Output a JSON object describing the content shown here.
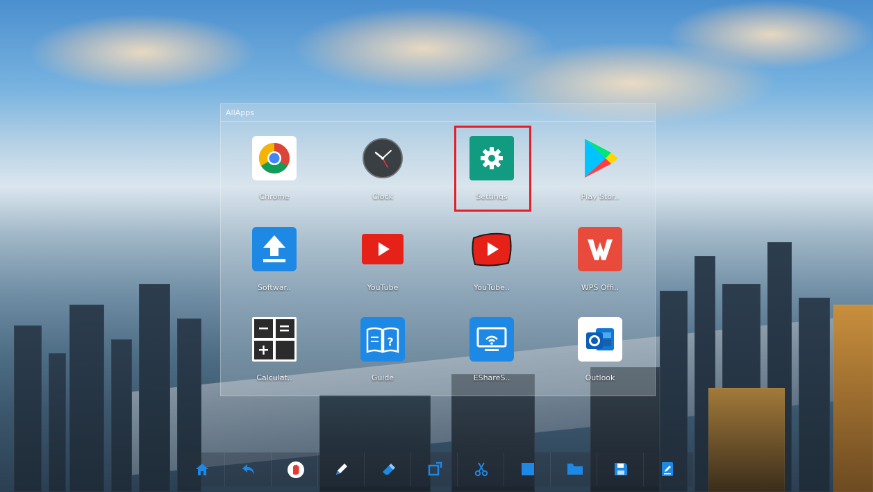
{
  "panel": {
    "title": "AllApps"
  },
  "apps": [
    {
      "label": "Chrome",
      "icon": "chrome-icon"
    },
    {
      "label": "Clock",
      "icon": "clock-icon"
    },
    {
      "label": "Settings",
      "icon": "settings-gear-icon"
    },
    {
      "label": "Play Stor..",
      "icon": "play-store-icon"
    },
    {
      "label": "Softwar..",
      "icon": "software-update-icon"
    },
    {
      "label": "YouTube",
      "icon": "youtube-icon"
    },
    {
      "label": "YouTube..",
      "icon": "youtube-kids-icon"
    },
    {
      "label": "WPS Offi..",
      "icon": "wps-office-icon"
    },
    {
      "label": "Calculat..",
      "icon": "calculator-icon"
    },
    {
      "label": "Guide",
      "icon": "guide-book-icon"
    },
    {
      "label": "EShareS..",
      "icon": "eshare-screen-icon"
    },
    {
      "label": "Outlook",
      "icon": "outlook-icon"
    }
  ],
  "highlight": {
    "target": "Settings",
    "color": "#e2202a"
  },
  "toolbar": {
    "tools": [
      "home-icon",
      "back-icon",
      "hand-stop-icon",
      "pen-icon",
      "eraser-icon",
      "crop-icon",
      "scissors-icon",
      "whiteboard-icon",
      "folder-icon",
      "save-icon",
      "note-edit-icon"
    ],
    "icon_color": "#1e88e5"
  }
}
